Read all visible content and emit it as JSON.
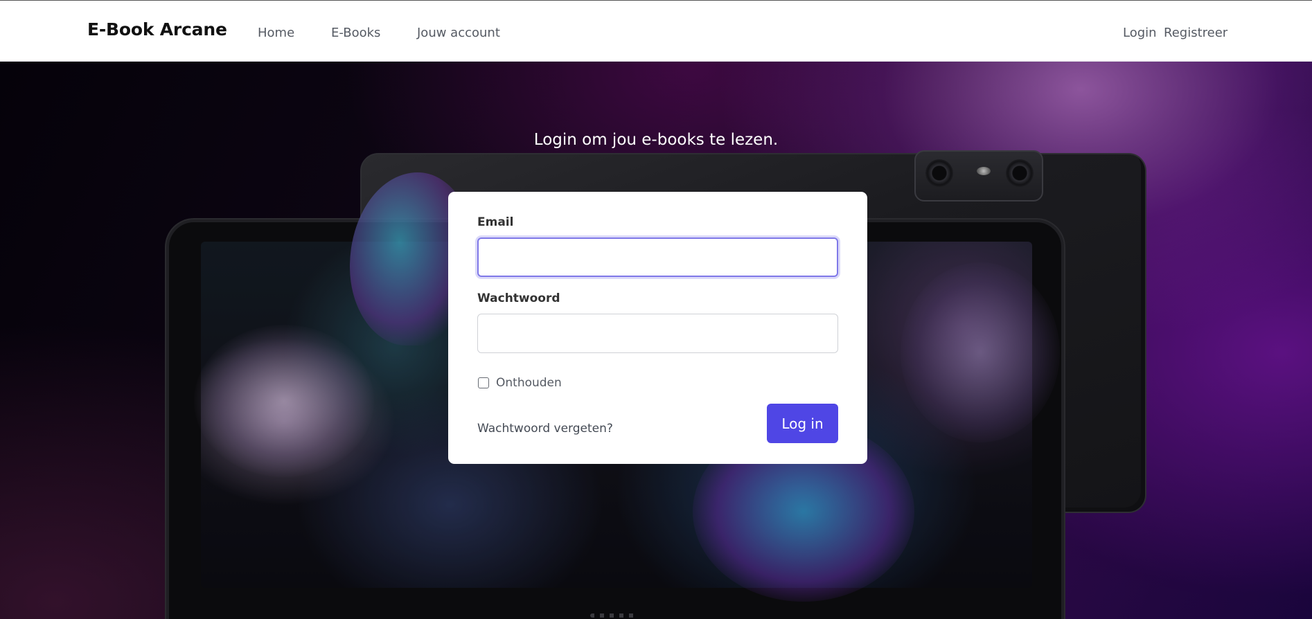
{
  "header": {
    "brand": "E-Book Arcane",
    "nav": {
      "home": "Home",
      "ebooks": "E-Books",
      "account": "Jouw account"
    },
    "auth": {
      "login": "Login",
      "register": "Registreer"
    }
  },
  "hero": {
    "heading": "Login om jou e-books te lezen."
  },
  "login_form": {
    "email_label": "Email",
    "email_value": "",
    "password_label": "Wachtwoord",
    "password_value": "",
    "remember_label": "Onthouden",
    "remember_checked": false,
    "forgot_link": "Wachtwoord vergeten?",
    "submit_label": "Log in"
  },
  "colors": {
    "accent": "#4f46e5",
    "focus_ring": "#7f78e8",
    "nav_text": "#555a63"
  }
}
